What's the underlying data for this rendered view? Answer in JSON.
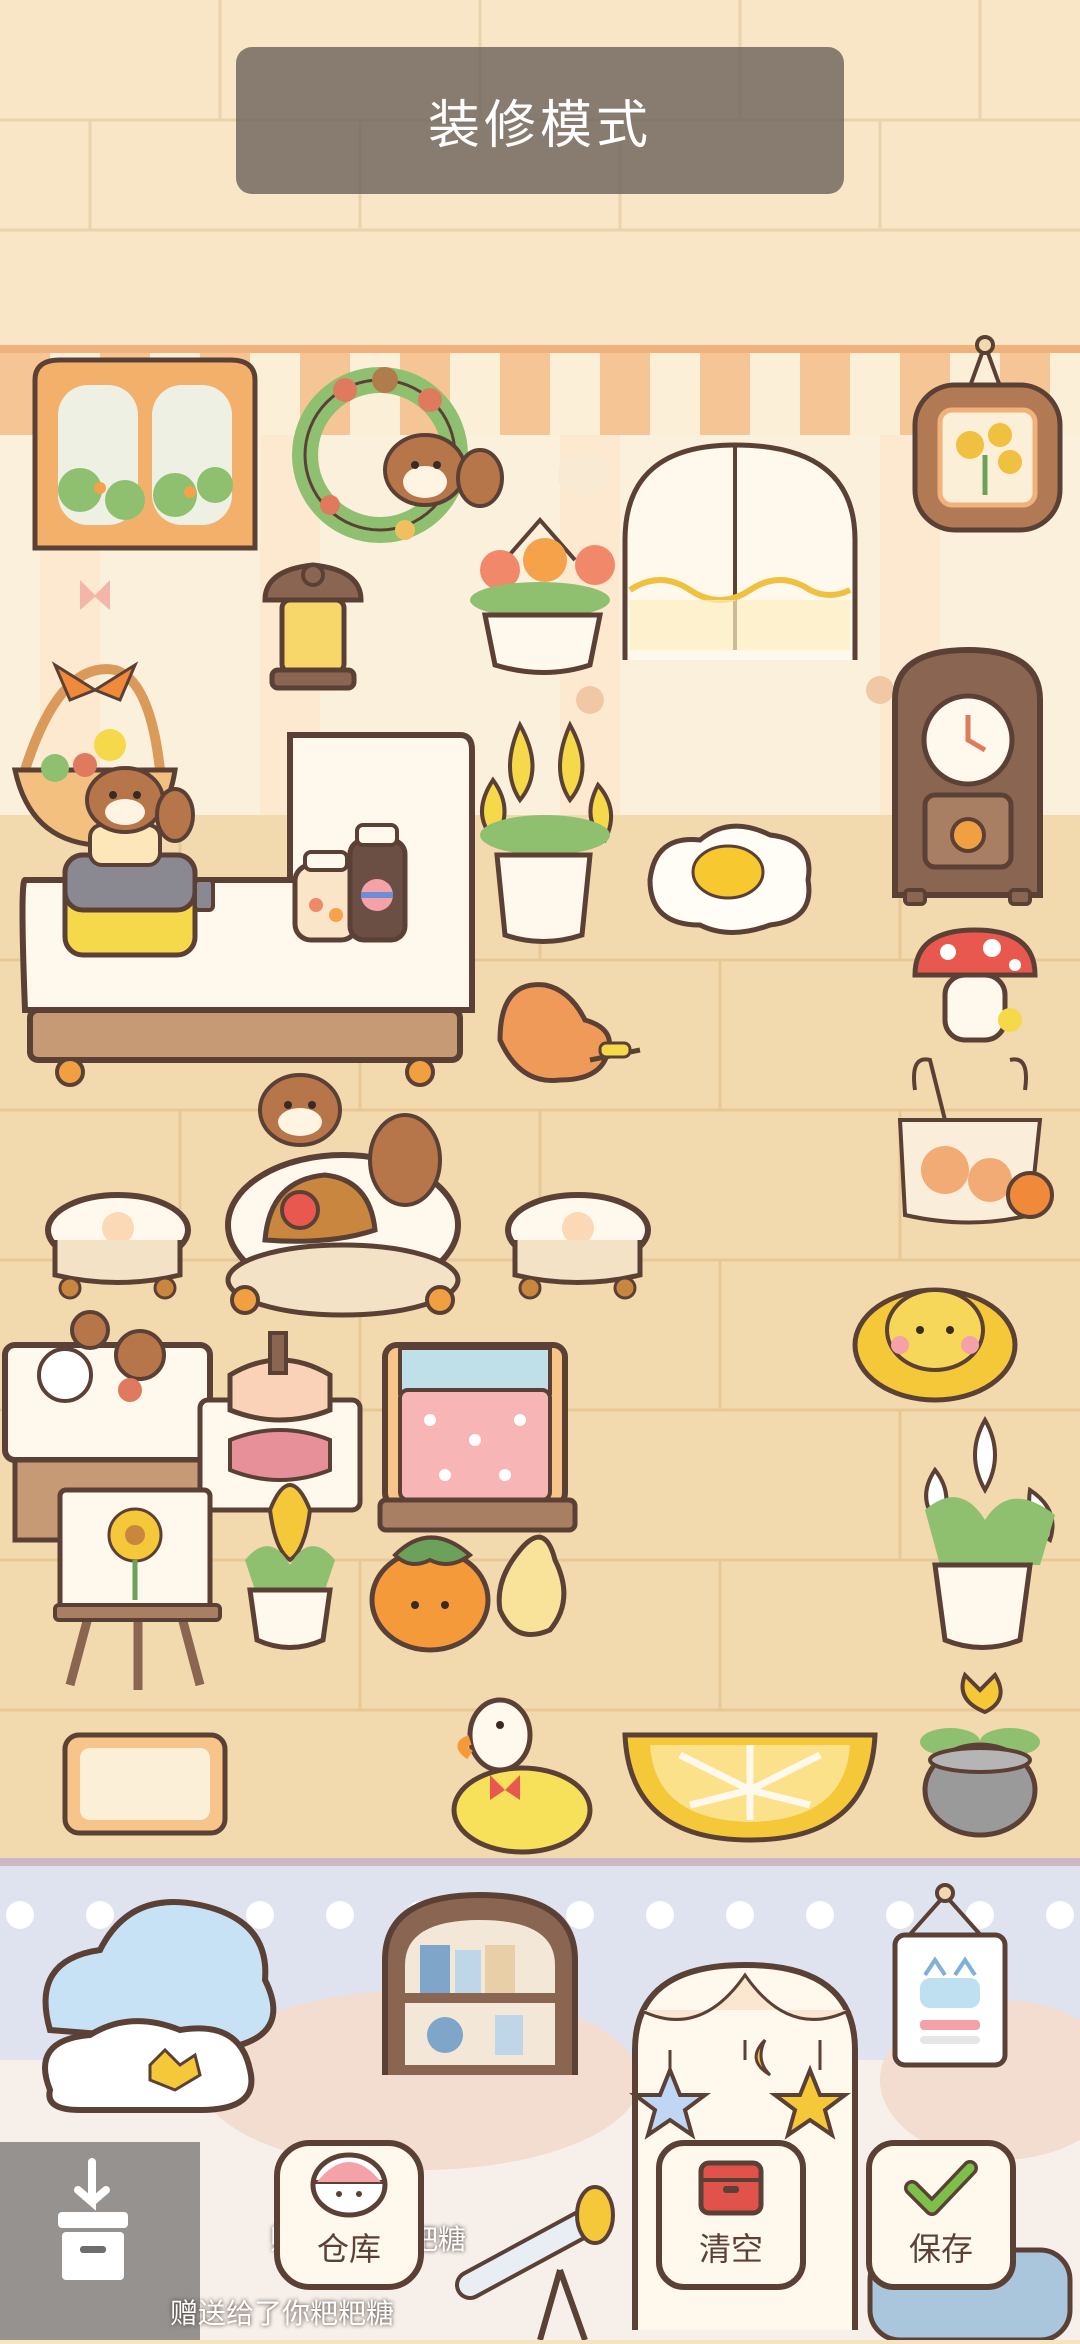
{
  "banner": {
    "title": "装修模式"
  },
  "toolbar": {
    "warehouse_label": "仓库",
    "clear_label": "清空",
    "save_label": "保存"
  },
  "ticker": {
    "line1": "赠送了你粑粑糖",
    "line2": "赠送给了你粑粑糖"
  },
  "colors": {
    "wall": "#f6e3c2",
    "floor": "#f3d9ae",
    "awning_stripe": "#f6c595",
    "outline": "#5b4036",
    "banner_bg": "#6e645c",
    "lower_room_bg": "#dfe3ef"
  },
  "icons": [
    "window-icon",
    "wreath-icon",
    "flower-frame-icon",
    "lantern-icon",
    "flower-pot-icon",
    "door-curtain-icon",
    "basket-icon",
    "squirrel-icon",
    "toaster-icon",
    "counter-icon",
    "jar-icon",
    "tulip-icon",
    "egg-rug-icon",
    "grandfather-clock-icon",
    "mushroom-icon",
    "leaf-icon",
    "shopping-bag-icon",
    "stool-icon",
    "round-table-icon",
    "hat-icon",
    "bed-icon",
    "easel-icon",
    "lily-icon",
    "persimmon-icon",
    "orange-rug-icon",
    "duck-icon",
    "bread-rug-icon",
    "cloud-icon",
    "shelf-icon",
    "calendar-icon",
    "star-icon",
    "telescope-icon",
    "inbox-icon"
  ]
}
